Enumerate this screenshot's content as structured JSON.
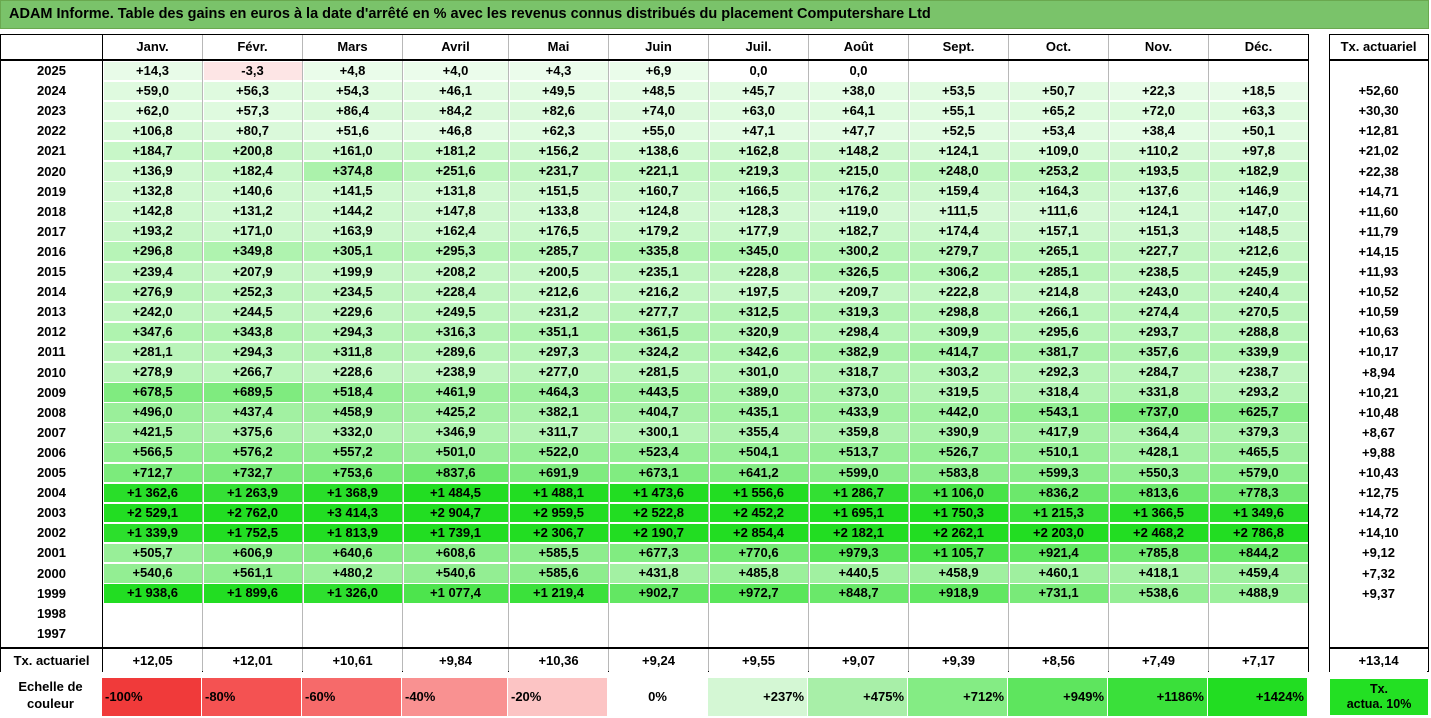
{
  "title": "ADAM Informe. Table des gains en euros à la date d'arrêté en % avec les revenus connus distribués du placement Computershare Ltd",
  "months": [
    "Janv.",
    "Févr.",
    "Mars",
    "Avril",
    "Mai",
    "Juin",
    "Juil.",
    "Août",
    "Sept.",
    "Oct.",
    "Nov.",
    "Déc."
  ],
  "tx_header": "Tx. actuariel",
  "rows": [
    {
      "year": "2025",
      "values": [
        "+14,3",
        "-3,3",
        "+4,8",
        "+4,0",
        "+4,3",
        "+6,9",
        "0,0",
        "0,0",
        "",
        "",
        "",
        ""
      ],
      "tx": ""
    },
    {
      "year": "2024",
      "values": [
        "+59,0",
        "+56,3",
        "+54,3",
        "+46,1",
        "+49,5",
        "+48,5",
        "+45,7",
        "+38,0",
        "+53,5",
        "+50,7",
        "+22,3",
        "+18,5"
      ],
      "tx": "+52,60"
    },
    {
      "year": "2023",
      "values": [
        "+62,0",
        "+57,3",
        "+86,4",
        "+84,2",
        "+82,6",
        "+74,0",
        "+63,0",
        "+64,1",
        "+55,1",
        "+65,2",
        "+72,0",
        "+63,3"
      ],
      "tx": "+30,30"
    },
    {
      "year": "2022",
      "values": [
        "+106,8",
        "+80,7",
        "+51,6",
        "+46,8",
        "+62,3",
        "+55,0",
        "+47,1",
        "+47,7",
        "+52,5",
        "+53,4",
        "+38,4",
        "+50,1"
      ],
      "tx": "+12,81"
    },
    {
      "year": "2021",
      "values": [
        "+184,7",
        "+200,8",
        "+161,0",
        "+181,2",
        "+156,2",
        "+138,6",
        "+162,8",
        "+148,2",
        "+124,1",
        "+109,0",
        "+110,2",
        "+97,8"
      ],
      "tx": "+21,02"
    },
    {
      "year": "2020",
      "values": [
        "+136,9",
        "+182,4",
        "+374,8",
        "+251,6",
        "+231,7",
        "+221,1",
        "+219,3",
        "+215,0",
        "+248,0",
        "+253,2",
        "+193,5",
        "+182,9"
      ],
      "tx": "+22,38"
    },
    {
      "year": "2019",
      "values": [
        "+132,8",
        "+140,6",
        "+141,5",
        "+131,8",
        "+151,5",
        "+160,7",
        "+166,5",
        "+176,2",
        "+159,4",
        "+164,3",
        "+137,6",
        "+146,9"
      ],
      "tx": "+14,71"
    },
    {
      "year": "2018",
      "values": [
        "+142,8",
        "+131,2",
        "+144,2",
        "+147,8",
        "+133,8",
        "+124,8",
        "+128,3",
        "+119,0",
        "+111,5",
        "+111,6",
        "+124,1",
        "+147,0"
      ],
      "tx": "+11,60"
    },
    {
      "year": "2017",
      "values": [
        "+193,2",
        "+171,0",
        "+163,9",
        "+162,4",
        "+176,5",
        "+179,2",
        "+177,9",
        "+182,7",
        "+174,4",
        "+157,1",
        "+151,3",
        "+148,5"
      ],
      "tx": "+11,79"
    },
    {
      "year": "2016",
      "values": [
        "+296,8",
        "+349,8",
        "+305,1",
        "+295,3",
        "+285,7",
        "+335,8",
        "+345,0",
        "+300,2",
        "+279,7",
        "+265,1",
        "+227,7",
        "+212,6"
      ],
      "tx": "+14,15"
    },
    {
      "year": "2015",
      "values": [
        "+239,4",
        "+207,9",
        "+199,9",
        "+208,2",
        "+200,5",
        "+235,1",
        "+228,8",
        "+326,5",
        "+306,2",
        "+285,1",
        "+238,5",
        "+245,9"
      ],
      "tx": "+11,93"
    },
    {
      "year": "2014",
      "values": [
        "+276,9",
        "+252,3",
        "+234,5",
        "+228,4",
        "+212,6",
        "+216,2",
        "+197,5",
        "+209,7",
        "+222,8",
        "+214,8",
        "+243,0",
        "+240,4"
      ],
      "tx": "+10,52"
    },
    {
      "year": "2013",
      "values": [
        "+242,0",
        "+244,5",
        "+229,6",
        "+249,5",
        "+231,2",
        "+277,7",
        "+312,5",
        "+319,3",
        "+298,8",
        "+266,1",
        "+274,4",
        "+270,5"
      ],
      "tx": "+10,59"
    },
    {
      "year": "2012",
      "values": [
        "+347,6",
        "+343,8",
        "+294,3",
        "+316,3",
        "+351,1",
        "+361,5",
        "+320,9",
        "+298,4",
        "+309,9",
        "+295,6",
        "+293,7",
        "+288,8"
      ],
      "tx": "+10,63"
    },
    {
      "year": "2011",
      "values": [
        "+281,1",
        "+294,3",
        "+311,8",
        "+289,6",
        "+297,3",
        "+324,2",
        "+342,6",
        "+382,9",
        "+414,7",
        "+381,7",
        "+357,6",
        "+339,9"
      ],
      "tx": "+10,17"
    },
    {
      "year": "2010",
      "values": [
        "+278,9",
        "+266,7",
        "+228,6",
        "+238,9",
        "+277,0",
        "+281,5",
        "+301,0",
        "+318,7",
        "+303,2",
        "+292,3",
        "+284,7",
        "+238,7"
      ],
      "tx": "+8,94"
    },
    {
      "year": "2009",
      "values": [
        "+678,5",
        "+689,5",
        "+518,4",
        "+461,9",
        "+464,3",
        "+443,5",
        "+389,0",
        "+373,0",
        "+319,5",
        "+318,4",
        "+331,8",
        "+293,2"
      ],
      "tx": "+10,21"
    },
    {
      "year": "2008",
      "values": [
        "+496,0",
        "+437,4",
        "+458,9",
        "+425,2",
        "+382,1",
        "+404,7",
        "+435,1",
        "+433,9",
        "+442,0",
        "+543,1",
        "+737,0",
        "+625,7"
      ],
      "tx": "+10,48"
    },
    {
      "year": "2007",
      "values": [
        "+421,5",
        "+375,6",
        "+332,0",
        "+346,9",
        "+311,7",
        "+300,1",
        "+355,4",
        "+359,8",
        "+390,9",
        "+417,9",
        "+364,4",
        "+379,3"
      ],
      "tx": "+8,67"
    },
    {
      "year": "2006",
      "values": [
        "+566,5",
        "+576,2",
        "+557,2",
        "+501,0",
        "+522,0",
        "+523,4",
        "+504,1",
        "+513,7",
        "+526,7",
        "+510,1",
        "+428,1",
        "+465,5"
      ],
      "tx": "+9,88"
    },
    {
      "year": "2005",
      "values": [
        "+712,7",
        "+732,7",
        "+753,6",
        "+837,6",
        "+691,9",
        "+673,1",
        "+641,2",
        "+599,0",
        "+583,8",
        "+599,3",
        "+550,3",
        "+579,0"
      ],
      "tx": "+10,43"
    },
    {
      "year": "2004",
      "values": [
        "+1 362,6",
        "+1 263,9",
        "+1 368,9",
        "+1 484,5",
        "+1 488,1",
        "+1 473,6",
        "+1 556,6",
        "+1 286,7",
        "+1 106,0",
        "+836,2",
        "+813,6",
        "+778,3"
      ],
      "tx": "+12,75"
    },
    {
      "year": "2003",
      "values": [
        "+2 529,1",
        "+2 762,0",
        "+3 414,3",
        "+2 904,7",
        "+2 959,5",
        "+2 522,8",
        "+2 452,2",
        "+1 695,1",
        "+1 750,3",
        "+1 215,3",
        "+1 366,5",
        "+1 349,6"
      ],
      "tx": "+14,72"
    },
    {
      "year": "2002",
      "values": [
        "+1 339,9",
        "+1 752,5",
        "+1 813,9",
        "+1 739,1",
        "+2 306,7",
        "+2 190,7",
        "+2 854,4",
        "+2 182,1",
        "+2 262,1",
        "+2 203,0",
        "+2 468,2",
        "+2 786,8"
      ],
      "tx": "+14,10"
    },
    {
      "year": "2001",
      "values": [
        "+505,7",
        "+606,9",
        "+640,6",
        "+608,6",
        "+585,5",
        "+677,3",
        "+770,6",
        "+979,3",
        "+1 105,7",
        "+921,4",
        "+785,8",
        "+844,2"
      ],
      "tx": "+9,12"
    },
    {
      "year": "2000",
      "values": [
        "+540,6",
        "+561,1",
        "+480,2",
        "+540,6",
        "+585,6",
        "+431,8",
        "+485,8",
        "+440,5",
        "+458,9",
        "+460,1",
        "+418,1",
        "+459,4"
      ],
      "tx": "+7,32"
    },
    {
      "year": "1999",
      "values": [
        "+1 938,6",
        "+1 899,6",
        "+1 326,0",
        "+1 077,4",
        "+1 219,4",
        "+902,7",
        "+972,7",
        "+848,7",
        "+918,9",
        "+731,1",
        "+538,6",
        "+488,9"
      ],
      "tx": "+9,37"
    },
    {
      "year": "1998",
      "values": [
        "",
        "",
        "",
        "",
        "",
        "",
        "",
        "",
        "",
        "",
        "",
        ""
      ],
      "tx": ""
    },
    {
      "year": "1997",
      "values": [
        "",
        "",
        "",
        "",
        "",
        "",
        "",
        "",
        "",
        "",
        "",
        ""
      ],
      "tx": ""
    }
  ],
  "footer": {
    "label": "Tx. actuariel",
    "values": [
      "+12,05",
      "+12,01",
      "+10,61",
      "+9,84",
      "+10,36",
      "+9,24",
      "+9,55",
      "+9,07",
      "+9,39",
      "+8,56",
      "+7,49",
      "+7,17"
    ],
    "tx": "+13,14"
  },
  "scale": {
    "label_line1": "Echelle de",
    "label_line2": "couleur",
    "items": [
      {
        "label": "-100%",
        "color": "#f03a3a",
        "align": "left"
      },
      {
        "label": "-80%",
        "color": "#f45252",
        "align": "left"
      },
      {
        "label": "-60%",
        "color": "#f66a6a",
        "align": "left"
      },
      {
        "label": "-40%",
        "color": "#f99191",
        "align": "left"
      },
      {
        "label": "-20%",
        "color": "#fcc4c4",
        "align": "left"
      },
      {
        "label": "0%",
        "color": "#ffffff",
        "align": "center"
      },
      {
        "label": "+237%",
        "color": "#d4f7d4",
        "align": "right"
      },
      {
        "label": "+475%",
        "color": "#a8efa8",
        "align": "right"
      },
      {
        "label": "+712%",
        "color": "#84ec84",
        "align": "right"
      },
      {
        "label": "+949%",
        "color": "#5ee55e",
        "align": "right"
      },
      {
        "label": "+1186%",
        "color": "#3ae03a",
        "align": "right"
      },
      {
        "label": "+1424%",
        "color": "#22dd22",
        "align": "right"
      }
    ],
    "side_line1": "Tx.",
    "side_line2": "actua. 10%",
    "side_color": "#23e023"
  },
  "colors": {
    "title_bg": "#7ac36a",
    "negative_light": "#fde8e8",
    "scale_top": "#22dd22"
  }
}
